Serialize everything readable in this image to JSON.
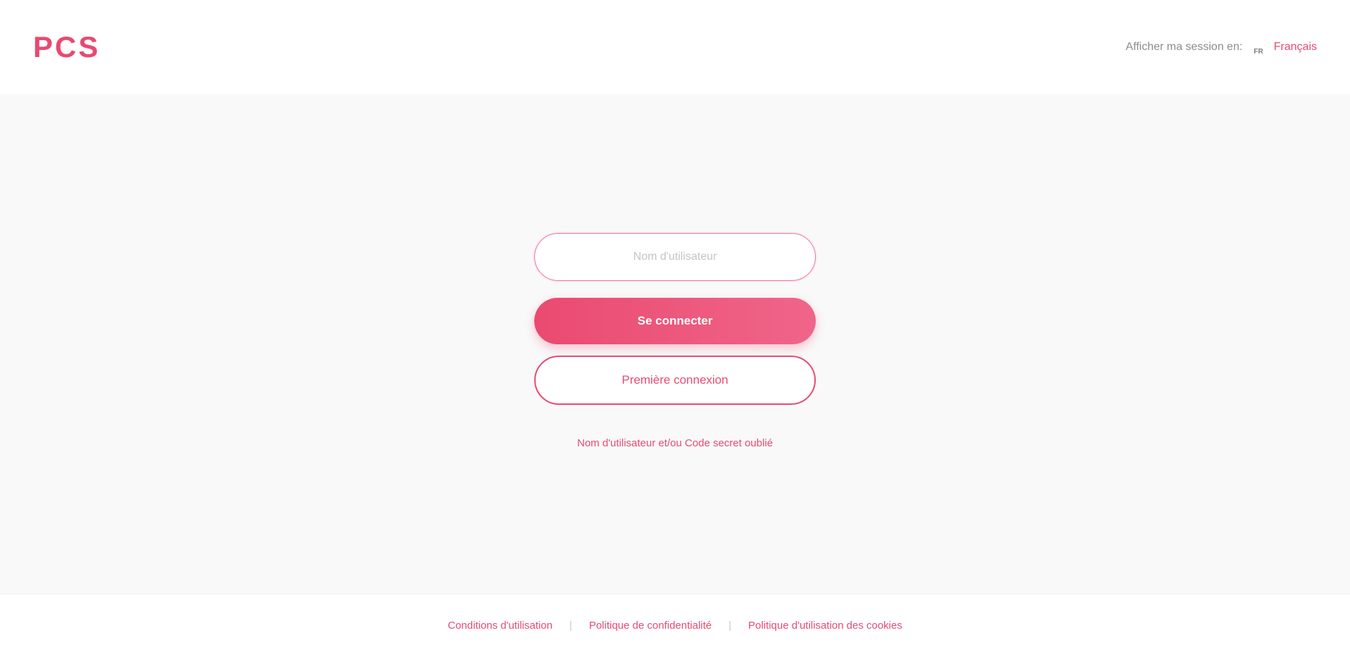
{
  "header": {
    "logo": "PCS",
    "language": {
      "label": "Afficher ma session en:",
      "flag_code": "FR",
      "selected": "Français"
    }
  },
  "login": {
    "username_placeholder": "Nom d'utilisateur",
    "submit_label": "Se connecter",
    "first_login_label": "Première connexion",
    "forgot_label": "Nom d'utilisateur et/ou Code secret oublié"
  },
  "footer": {
    "links": [
      "Conditions d'utilisation",
      "Politique de confidentialité",
      "Politique d'utilisation des cookies"
    ],
    "separator": "|"
  },
  "colors": {
    "brand": "#e84a71",
    "background": "#f9f9f9"
  }
}
